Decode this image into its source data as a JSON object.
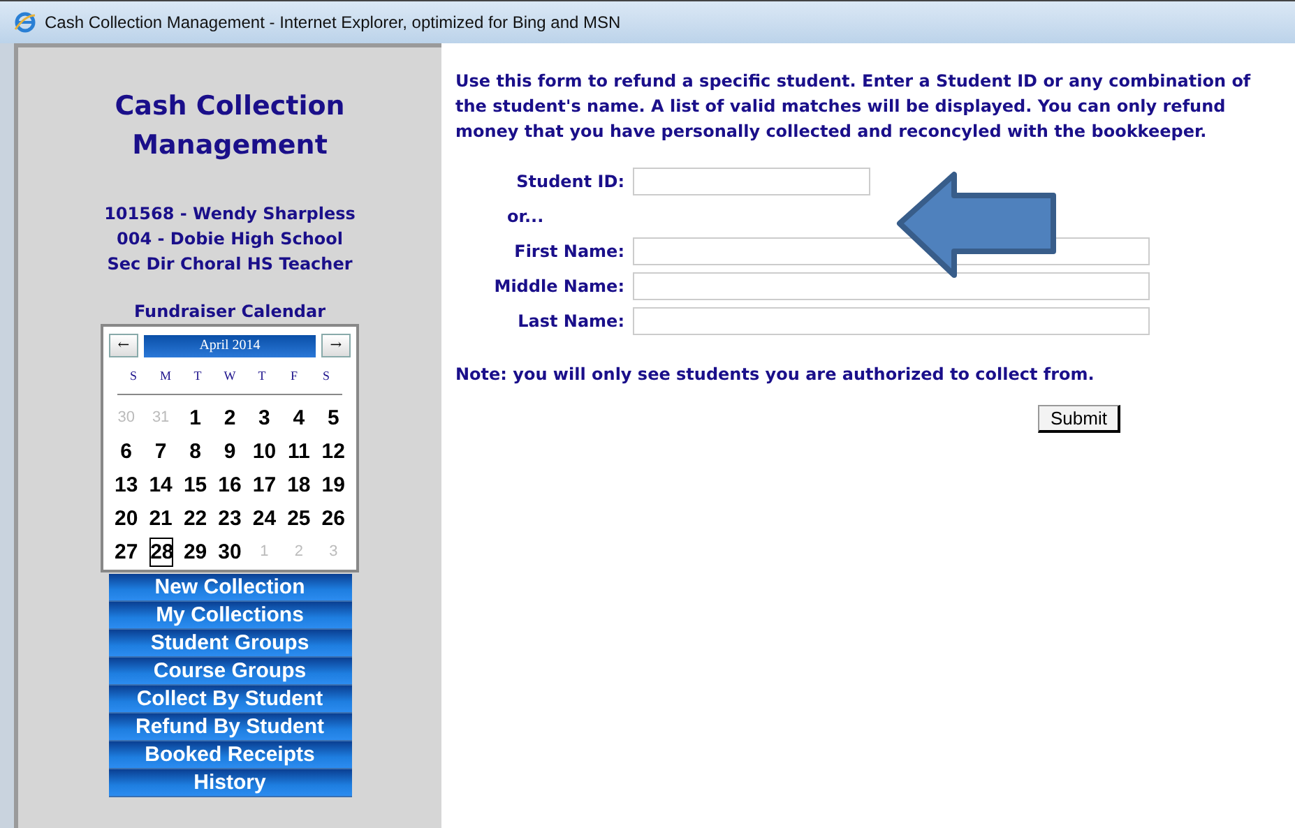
{
  "window": {
    "title": "Cash Collection Management - Internet Explorer, optimized for Bing and MSN"
  },
  "sidebar": {
    "app_title": "Cash Collection Management",
    "user_lines": [
      "101568 - Wendy Sharpless",
      "004 - Dobie High School",
      "Sec Dir Choral HS Teacher"
    ],
    "calendar": {
      "title": "Fundraiser Calendar",
      "month": "April 2014",
      "prev": "←",
      "next": "→",
      "weekdays": [
        "S",
        "M",
        "T",
        "W",
        "T",
        "F",
        "S"
      ],
      "days": [
        {
          "label": "30",
          "muted": true,
          "selected": false
        },
        {
          "label": "31",
          "muted": true,
          "selected": false
        },
        {
          "label": "1",
          "muted": false,
          "selected": false
        },
        {
          "label": "2",
          "muted": false,
          "selected": false
        },
        {
          "label": "3",
          "muted": false,
          "selected": false
        },
        {
          "label": "4",
          "muted": false,
          "selected": false
        },
        {
          "label": "5",
          "muted": false,
          "selected": false
        },
        {
          "label": "6",
          "muted": false,
          "selected": false
        },
        {
          "label": "7",
          "muted": false,
          "selected": false
        },
        {
          "label": "8",
          "muted": false,
          "selected": false
        },
        {
          "label": "9",
          "muted": false,
          "selected": false
        },
        {
          "label": "10",
          "muted": false,
          "selected": false
        },
        {
          "label": "11",
          "muted": false,
          "selected": false
        },
        {
          "label": "12",
          "muted": false,
          "selected": false
        },
        {
          "label": "13",
          "muted": false,
          "selected": false
        },
        {
          "label": "14",
          "muted": false,
          "selected": false
        },
        {
          "label": "15",
          "muted": false,
          "selected": false
        },
        {
          "label": "16",
          "muted": false,
          "selected": false
        },
        {
          "label": "17",
          "muted": false,
          "selected": false
        },
        {
          "label": "18",
          "muted": false,
          "selected": false
        },
        {
          "label": "19",
          "muted": false,
          "selected": false
        },
        {
          "label": "20",
          "muted": false,
          "selected": false
        },
        {
          "label": "21",
          "muted": false,
          "selected": false
        },
        {
          "label": "22",
          "muted": false,
          "selected": false
        },
        {
          "label": "23",
          "muted": false,
          "selected": false
        },
        {
          "label": "24",
          "muted": false,
          "selected": false
        },
        {
          "label": "25",
          "muted": false,
          "selected": false
        },
        {
          "label": "26",
          "muted": false,
          "selected": false
        },
        {
          "label": "27",
          "muted": false,
          "selected": false
        },
        {
          "label": "28",
          "muted": false,
          "selected": true
        },
        {
          "label": "29",
          "muted": false,
          "selected": false
        },
        {
          "label": "30",
          "muted": false,
          "selected": false
        },
        {
          "label": "1",
          "muted": true,
          "selected": false
        },
        {
          "label": "2",
          "muted": true,
          "selected": false
        },
        {
          "label": "3",
          "muted": true,
          "selected": false
        }
      ]
    },
    "nav": [
      "New Collection",
      "My Collections",
      "Student Groups",
      "Course Groups",
      "Collect By Student",
      "Refund By Student",
      "Booked Receipts",
      "History"
    ]
  },
  "main": {
    "intro": "Use this form to refund a specific student. Enter a Student ID or any combination of the student's name. A list of valid matches will be displayed. You can only refund money that you have personally collected and reconcyled with the bookkeeper.",
    "fields": [
      {
        "kind": "short",
        "label": "Student ID:"
      },
      {
        "kind": "separator",
        "label": "or..."
      },
      {
        "kind": "long",
        "label": "First Name:"
      },
      {
        "kind": "long",
        "label": "Middle Name:"
      },
      {
        "kind": "long",
        "label": "Last Name:"
      }
    ],
    "note": "Note: you will only see students you are authorized to collect from.",
    "submit": "Submit"
  }
}
